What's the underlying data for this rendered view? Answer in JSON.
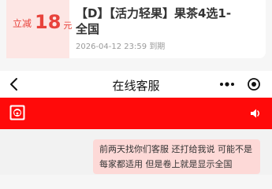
{
  "coupon": {
    "amount_prefix": "立减",
    "amount": "18",
    "amount_unit": "元",
    "title": "【D】【活力轻果】果茶4选1-全国",
    "expiry_date": "2026-04-12 23:59",
    "expiry_suffix": "到期"
  },
  "nav": {
    "title": "在线客服",
    "icons": [
      "back-arrow-icon",
      "more-dots-icon",
      "close-circle-icon"
    ]
  },
  "header": {
    "icons": [
      "brand-logo-icon",
      "volume-icon"
    ]
  },
  "chat": {
    "messages": [
      {
        "text": "前两天找你们客服 还打给我说 可能不是每家都适用 但是卷上就是显示全国"
      }
    ]
  },
  "colors": {
    "accent_red": "#ff0a0a",
    "coupon_red": "#e8433c",
    "bubble_pink": "#fdd9d7",
    "coupon_left_bg": "#fde6e4"
  }
}
